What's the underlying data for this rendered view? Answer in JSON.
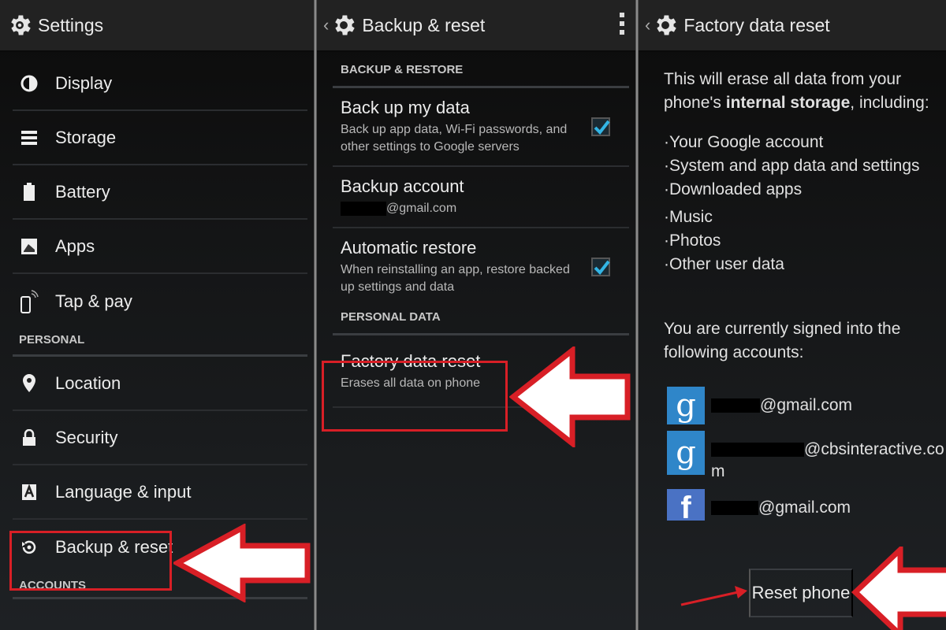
{
  "panels": {
    "settings": {
      "title": "Settings",
      "items_top": [
        {
          "label": "Display",
          "icon": "display-icon"
        },
        {
          "label": "Storage",
          "icon": "storage-icon"
        },
        {
          "label": "Battery",
          "icon": "battery-icon"
        },
        {
          "label": "Apps",
          "icon": "apps-icon"
        },
        {
          "label": "Tap & pay",
          "icon": "tap-pay-icon"
        }
      ],
      "section_personal": "PERSONAL",
      "items_personal": [
        {
          "label": "Location",
          "icon": "location-icon"
        },
        {
          "label": "Security",
          "icon": "lock-icon"
        },
        {
          "label": "Language & input",
          "icon": "language-icon"
        },
        {
          "label": "Backup & reset",
          "icon": "backup-icon"
        }
      ],
      "section_accounts": "ACCOUNTS"
    },
    "backup": {
      "back": "‹",
      "title": "Backup & reset",
      "section_backup": "BACKUP & RESTORE",
      "backup_my_data": {
        "title": "Back up my data",
        "summary": "Back up app data, Wi-Fi passwords, and other settings to Google servers",
        "checked": true
      },
      "backup_account": {
        "title": "Backup account",
        "summary": "@gmail.com"
      },
      "auto_restore": {
        "title": "Automatic restore",
        "summary": "When reinstalling an app, restore backed up settings and data",
        "checked": true
      },
      "section_personal": "PERSONAL DATA",
      "factory_reset": {
        "title": "Factory data reset",
        "summary": "Erases all data on phone"
      }
    },
    "factory": {
      "back": "‹",
      "title": "Factory data reset",
      "intro_pre": "This will erase all data from your phone's ",
      "intro_bold": "internal storage",
      "intro_post": ", including:",
      "erase_list": [
        "·Your Google account",
        "·System and app data and settings",
        "·Downloaded apps",
        "·Music",
        "·Photos",
        "·Other user data"
      ],
      "signed_in": "You are currently signed into the following accounts:",
      "accounts": [
        {
          "type": "google",
          "glyph": "g",
          "suffix": "@gmail.com"
        },
        {
          "type": "google",
          "glyph": "g",
          "suffix": "@cbsinteractive.com"
        },
        {
          "type": "facebook",
          "glyph": "f",
          "suffix": "@gmail.com"
        }
      ],
      "reset_button": "Reset phone"
    }
  },
  "colors": {
    "highlight": "#d81f26",
    "checkbox": "#33b5e5",
    "google": "#2f86c9",
    "facebook": "#4a72c4"
  }
}
